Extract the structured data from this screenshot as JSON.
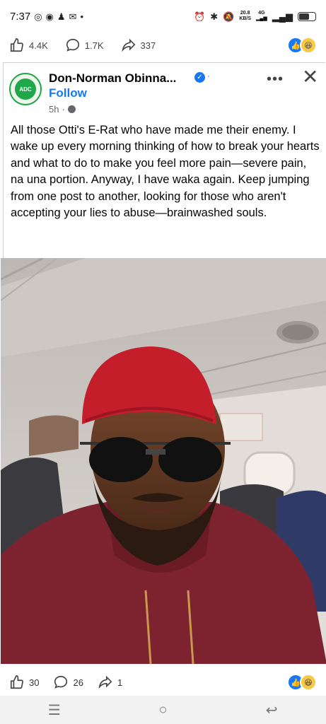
{
  "status": {
    "time": "7:37",
    "net_speed_value": "20.8",
    "net_speed_unit": "KB/S",
    "network_type": "4G"
  },
  "top_counts": {
    "likes": "4.4K",
    "comments": "1.7K",
    "shares": "337"
  },
  "post": {
    "author": "Don-Norman Obinna...",
    "follow_label": "Follow",
    "time_ago": "5h",
    "avatar_text": "ADC",
    "text": "All those Otti's E-Rat who have made me their enemy. I wake up every morning thinking of how to break your hearts and what to do to make you feel more pain—severe pain, na una portion. Anyway, I have waka again. Keep jumping from one post to another, looking for those who aren't accepting your lies to abuse—brainwashed souls."
  },
  "bottom_counts": {
    "likes": "30",
    "comments": "26",
    "shares": "1"
  },
  "colors": {
    "brand_blue": "#1877f2",
    "adc_green": "#1fa84a"
  }
}
